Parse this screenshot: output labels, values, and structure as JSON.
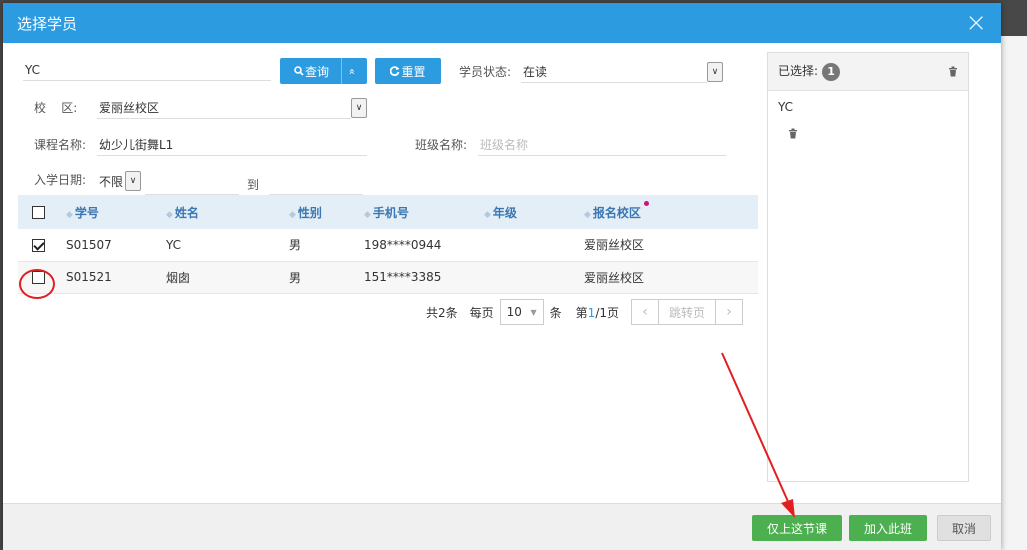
{
  "modal": {
    "title": "选择学员",
    "close": "×"
  },
  "filters": {
    "keyword_value": "YC",
    "search_label": "查询",
    "collapse_icon": "»",
    "reset_label": "重置",
    "status_label": "学员状态:",
    "status_value": "在读",
    "campus_label": "校    区:",
    "campus_value": "爱丽丝校区",
    "course_label": "课程名称:",
    "course_value": "幼少儿街舞L1",
    "class_label": "班级名称:",
    "class_placeholder": "班级名称",
    "date_label": "入学日期:",
    "date_mode": "不限",
    "date_to": "到"
  },
  "table": {
    "headers": [
      "学号",
      "姓名",
      "性别",
      "手机号",
      "年级",
      "报名校区"
    ],
    "rows": [
      {
        "checked": true,
        "id": "S01507",
        "name": "YC",
        "gender": "男",
        "phone": "198****0944",
        "grade": "",
        "campus": "爱丽丝校区"
      },
      {
        "checked": false,
        "id": "S01521",
        "name": "烟囱",
        "gender": "男",
        "phone": "151****3385",
        "grade": "",
        "campus": "爱丽丝校区"
      }
    ]
  },
  "pager": {
    "total": "共2条",
    "per_page_label": "每页",
    "per_page_value": "10",
    "unit": "条",
    "page_prefix": "第",
    "page_current": "1",
    "page_suffix": "/1页",
    "jump_label": "跳转页",
    "prev": "‹",
    "next": "›"
  },
  "selected": {
    "title": "已选择:",
    "count": "1",
    "items": [
      "YC"
    ]
  },
  "footer": {
    "only_this_lesson": "仅上这节课",
    "join_class": "加入此班",
    "cancel": "取消"
  },
  "icons": {
    "search": "search-icon",
    "reset": "refresh-icon",
    "trash": "trash-icon",
    "sort": "sort-icon"
  },
  "colors": {
    "header": "#2d9be0",
    "green": "#4caf50",
    "annotation_red": "#e02020"
  }
}
